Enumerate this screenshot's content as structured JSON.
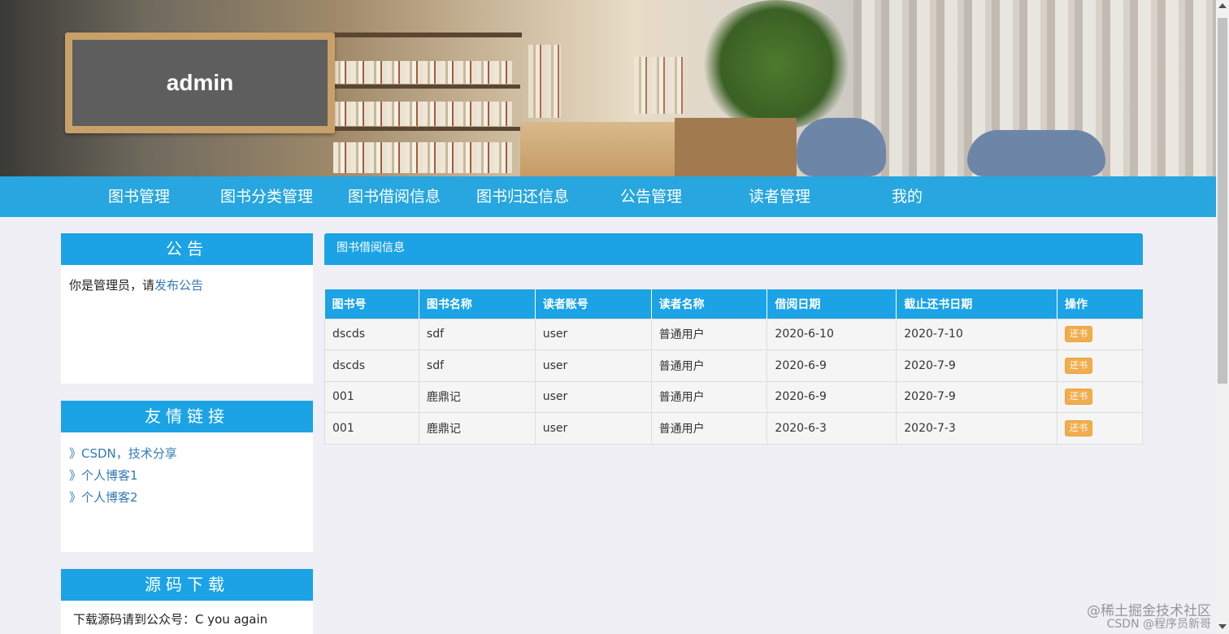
{
  "header": {
    "title": "admin"
  },
  "nav": {
    "items": [
      {
        "label": "图书管理"
      },
      {
        "label": "图书分类管理"
      },
      {
        "label": "图书借阅信息"
      },
      {
        "label": "图书归还信息"
      },
      {
        "label": "公告管理"
      },
      {
        "label": "读者管理"
      },
      {
        "label": "我的"
      }
    ]
  },
  "sidebar": {
    "notice": {
      "title": "公告",
      "text": "你是管理员，请",
      "link": "发布公告"
    },
    "links": {
      "title": "友情链接",
      "items": [
        {
          "label": "》CSDN，技术分享"
        },
        {
          "label": "》个人博客1"
        },
        {
          "label": "》个人博客2"
        }
      ]
    },
    "download": {
      "title": "源码下载",
      "text": "下载源码请到公众号：C you again"
    }
  },
  "main": {
    "title": "图书借阅信息",
    "columns": [
      "图书号",
      "图书名称",
      "读者账号",
      "读者名称",
      "借阅日期",
      "截止还书日期",
      "操作"
    ],
    "rows": [
      {
        "book_id": "dscds",
        "book_name": "sdf",
        "account": "user",
        "reader": "普通用户",
        "borrow_date": "2020-6-10",
        "due_date": "2020-7-10",
        "action": "还书"
      },
      {
        "book_id": "dscds",
        "book_name": "sdf",
        "account": "user",
        "reader": "普通用户",
        "borrow_date": "2020-6-9",
        "due_date": "2020-7-9",
        "action": "还书"
      },
      {
        "book_id": "001",
        "book_name": "鹿鼎记",
        "account": "user",
        "reader": "普通用户",
        "borrow_date": "2020-6-9",
        "due_date": "2020-7-9",
        "action": "还书"
      },
      {
        "book_id": "001",
        "book_name": "鹿鼎记",
        "account": "user",
        "reader": "普通用户",
        "borrow_date": "2020-6-3",
        "due_date": "2020-7-3",
        "action": "还书"
      }
    ]
  },
  "watermark": {
    "line1": "@稀土掘金技术社区",
    "line2": "CSDN @程序员新哥"
  },
  "colors": {
    "accent": "#1ba3e6",
    "nav": "#27a6e0",
    "button": "#f0ad4e",
    "background": "#f0eff5"
  }
}
